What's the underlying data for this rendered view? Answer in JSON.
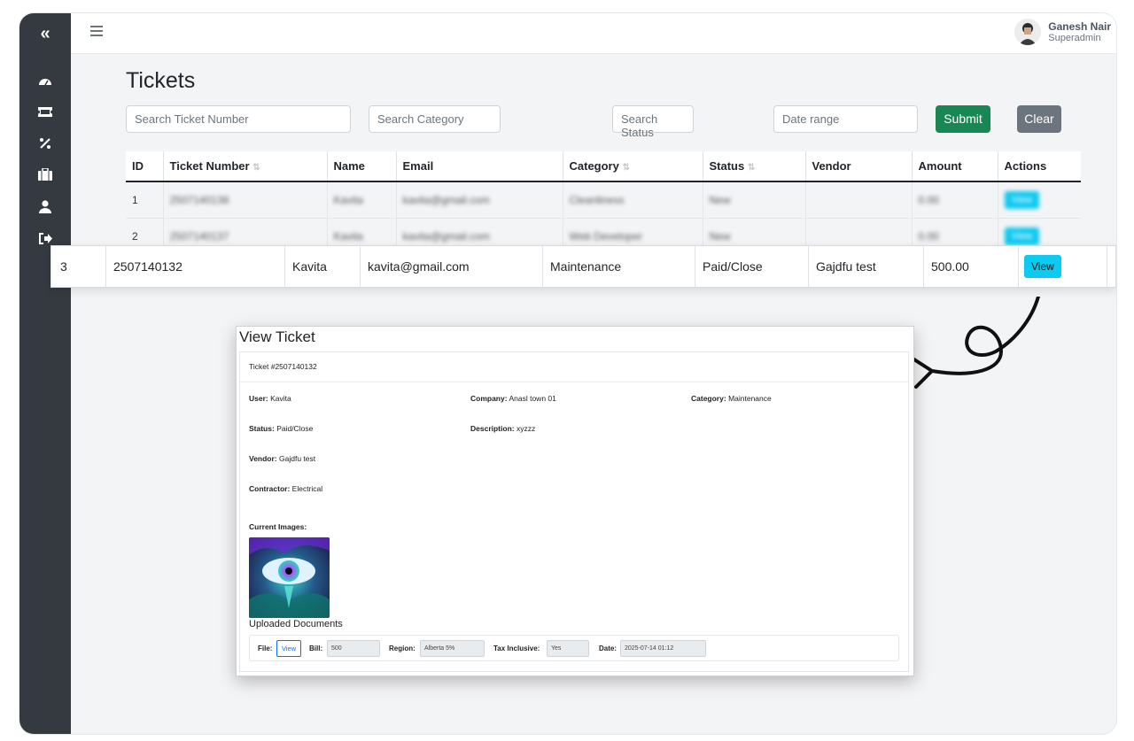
{
  "sidebar": {
    "toggle_icon": "chevrons-left-icon",
    "items": [
      {
        "icon": "dashboard-gauge-icon"
      },
      {
        "icon": "ticket-icon"
      },
      {
        "icon": "percent-icon"
      },
      {
        "icon": "briefcase-icon"
      },
      {
        "icon": "user-icon"
      },
      {
        "icon": "sign-out-icon"
      }
    ]
  },
  "header": {
    "user_name": "Ganesh Nair",
    "user_role": "Superadmin"
  },
  "page": {
    "title": "Tickets"
  },
  "filters": {
    "ticket_number_placeholder": "Search Ticket Number",
    "category_placeholder": "Search Category",
    "status_placeholder": "Search Status",
    "date_placeholder": "Date range",
    "submit_label": "Submit",
    "clear_label": "Clear"
  },
  "table": {
    "headers": {
      "id": "ID",
      "ticket_number": "Ticket Number",
      "name": "Name",
      "email": "Email",
      "category": "Category",
      "status": "Status",
      "vendor": "Vendor",
      "amount": "Amount",
      "actions": "Actions"
    },
    "rows": [
      {
        "id": "1",
        "ticket_number": "2507140138",
        "name": "Kavita",
        "email": "kavita@gmail.com",
        "category": "Cleanliness",
        "status": "New",
        "vendor": "",
        "amount": "0.00",
        "action": "View"
      },
      {
        "id": "2",
        "ticket_number": "2507140137",
        "name": "Kavita",
        "email": "kavita@gmail.com",
        "category": "Web Developer",
        "status": "New",
        "vendor": "",
        "amount": "0.00",
        "action": "View"
      }
    ],
    "highlight_row": {
      "id": "3",
      "ticket_number": "2507140132",
      "name": "Kavita",
      "email": "kavita@gmail.com",
      "category": "Maintenance",
      "status": "Paid/Close",
      "vendor": "Gajdfu test",
      "amount": "500.00",
      "action": "View"
    }
  },
  "modal": {
    "title": "View Ticket",
    "ticket_header": "Ticket #2507140132",
    "user_label": "User:",
    "user_value": "Kavita",
    "company_label": "Company:",
    "company_value": "Anasl town 01",
    "category_label": "Category:",
    "category_value": "Maintenance",
    "status_label": "Status:",
    "status_value": "Paid/Close",
    "description_label": "Description:",
    "description_value": "xyzzz",
    "vendor_label": "Vendor:",
    "vendor_value": "Gajdfu test",
    "contractor_label": "Contractor:",
    "contractor_value": "Electrical",
    "images_label": "Current Images:",
    "documents_title": "Uploaded Documents",
    "documents": {
      "file_label": "File:",
      "file_button": "View",
      "bill_label": "Bill:",
      "bill_value": "500",
      "region_label": "Region:",
      "region_value": "Alberta 5%",
      "tax_label": "Tax Inclusive:",
      "tax_value": "Yes",
      "date_label": "Date:",
      "date_value": "2025-07-14 01:12"
    }
  },
  "colors": {
    "sidebar_bg": "#343a40",
    "submit": "#198754",
    "clear": "#6c757d",
    "view": "#0dcaf0"
  }
}
